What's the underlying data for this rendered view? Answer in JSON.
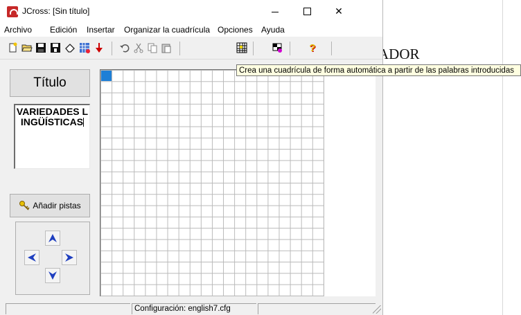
{
  "window": {
    "title": "JCross: [Sin título]"
  },
  "menu": [
    "Archivo",
    "Edición",
    "Insertar",
    "Organizar la cuadrícula",
    "Opciones",
    "Ayuda"
  ],
  "toolbar": {
    "icons": [
      "new-file",
      "open-folder",
      "save-disk",
      "save-as-disk",
      "eraser",
      "magic-grid",
      "red-arrow-down",
      "undo",
      "cut",
      "copy",
      "paste",
      "auto-grid",
      "flag",
      "help"
    ]
  },
  "tooltip": {
    "text": "Crea una cuadrícula de forma automática a partir de las palabras introducidas"
  },
  "background_doc": {
    "text": "ADOR"
  },
  "sidebar": {
    "title_button": "Título",
    "title_value": "VARIEDADES LINGÜÍSTICAS",
    "add_clues_button": "Añadir pistas"
  },
  "grid": {
    "columns": 20,
    "rows": 20,
    "selected_cell": [
      1,
      1
    ]
  },
  "status": {
    "config": "Configuración: english7.cfg"
  },
  "colors": {
    "selected_cell": "#1e7fd6",
    "tooltip_bg": "#ffffe1",
    "arrow_blue": "#1f3fbf"
  }
}
